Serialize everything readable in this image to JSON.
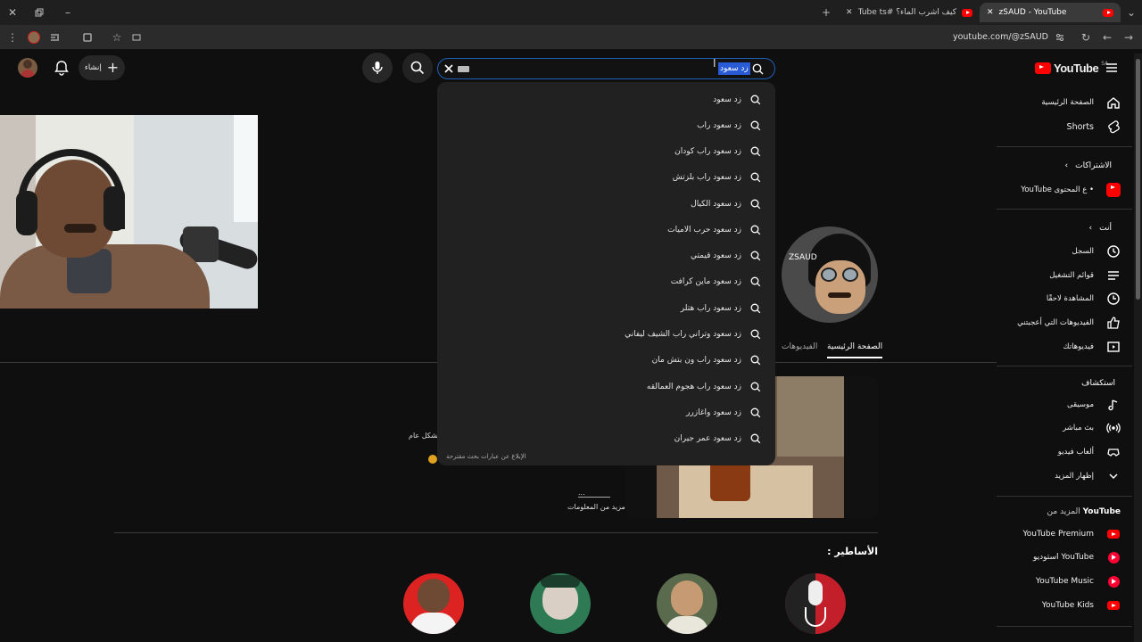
{
  "browser": {
    "tabs": [
      {
        "title": "zSAUD - YouTube",
        "active": true
      },
      {
        "title": "كيف اشرب الماء؟ #YouTube ts",
        "active": false
      }
    ],
    "address": "youtube.com/@zSAUD"
  },
  "header": {
    "logo_text": "YouTube",
    "region": "SA",
    "create_label": "إنشاء",
    "search_value": "زد سعود",
    "avatar_icon": "avatar-user"
  },
  "suggestions": [
    "زد سعود",
    "زد سعود راب",
    "زد سعود راب كودان",
    "زد سعود راب بلزتش",
    "زد سعود الكيال",
    "زد سعود حرب الاميات",
    "زد سعود قيمتي",
    "زد سعود ماين كرافت",
    "زد سعود راب هتلر",
    "زد سعود وتراني راب الشيف ليفاني",
    "زد سعود راب ون بتش مان",
    "زد سعود راب هجوم العمالقه",
    "زد سعود واغازرر",
    "زد سعود عمر جيران"
  ],
  "dropdown_footer": "الإبلاغ عن عبارات بحث مقترحة",
  "sidebar": {
    "top": [
      {
        "label": "الصفحة الرئيسية",
        "icon": "home-icon"
      },
      {
        "label": "Shorts",
        "icon": "shorts-icon"
      }
    ],
    "subs_head": "الاشتراكات",
    "subs": [
      {
        "label": "YouTube ع المحتوى •",
        "icon": "youtube-channel-icon"
      }
    ],
    "you_head": "أنت",
    "you": [
      {
        "label": "السجل",
        "icon": "history-icon"
      },
      {
        "label": "قوائم التشغيل",
        "icon": "playlists-icon"
      },
      {
        "label": "المشاهدة لاحقًا",
        "icon": "watch-later-icon"
      },
      {
        "label": "الفيديوهات التي أعجبتني",
        "icon": "like-icon"
      },
      {
        "label": "فيديوهاتك",
        "icon": "your-videos-icon"
      }
    ],
    "explore_head": "استكشاف",
    "explore": [
      {
        "label": "موسيقى",
        "icon": "music-icon"
      },
      {
        "label": "بث مباشر",
        "icon": "live-icon"
      },
      {
        "label": "ألعاب فيديو",
        "icon": "gaming-icon"
      },
      {
        "label": "إظهار المزيد",
        "icon": "chevron-down-icon"
      }
    ],
    "more_head_prefix": "المزيد من",
    "more_head_brand": "YouTube",
    "more": [
      {
        "label": "YouTube Premium",
        "icon": "yt-premium-icon"
      },
      {
        "label": "استوديو YouTube",
        "icon": "yt-studio-icon"
      },
      {
        "label": "YouTube Music",
        "icon": "yt-music-icon"
      },
      {
        "label": "YouTube Kids",
        "icon": "yt-kids-icon"
      }
    ]
  },
  "channel": {
    "tab_home": "الصفحة الرئيسية",
    "tab_videos": "الفيديوهات",
    "about_text": "بشكل عام",
    "more_info": "مزيد من المعلومات",
    "ellipsis": "...",
    "section_title": "الأساطير :"
  },
  "colors": {
    "accent": "#ff0000",
    "focus": "#1c62b9",
    "bg": "#0f0f0f"
  }
}
